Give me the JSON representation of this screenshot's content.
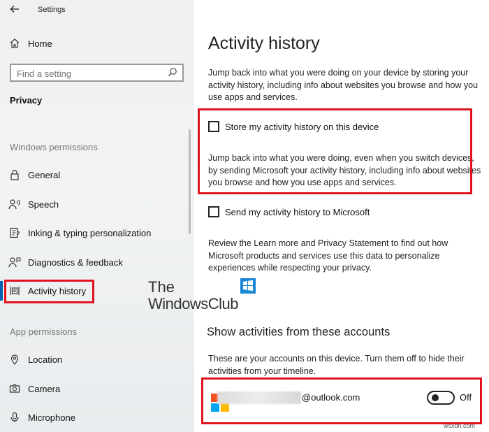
{
  "window": {
    "title": "Settings"
  },
  "sidebar": {
    "home_label": "Home",
    "search_placeholder": "Find a setting",
    "category": "Privacy",
    "windows_permissions_heading": "Windows permissions",
    "windows_items": [
      {
        "label": "General",
        "icon": "lock-icon"
      },
      {
        "label": "Speech",
        "icon": "speech-icon"
      },
      {
        "label": "Inking & typing personalization",
        "icon": "inking-icon"
      },
      {
        "label": "Diagnostics & feedback",
        "icon": "diagnostics-icon"
      },
      {
        "label": "Activity history",
        "icon": "activity-history-icon",
        "selected": true
      }
    ],
    "app_permissions_heading": "App permissions",
    "app_items": [
      {
        "label": "Location",
        "icon": "location-icon"
      },
      {
        "label": "Camera",
        "icon": "camera-icon"
      },
      {
        "label": "Microphone",
        "icon": "microphone-icon"
      }
    ]
  },
  "main": {
    "title": "Activity history",
    "intro": "Jump back into what you were doing on your device by storing your activity history, including info about websites you browse and how you use apps and services.",
    "store_checkbox": {
      "label": "Store my activity history on this device",
      "checked": false
    },
    "store_description": "Jump back into what you were doing, even when you switch devices, by sending Microsoft your activity history, including info about websites you browse and how you use apps and services.",
    "send_checkbox": {
      "label": "Send my activity history to Microsoft",
      "checked": false
    },
    "review_text": "Review the Learn more and Privacy Statement to find out how Microsoft products and services use this data to personalize experiences while respecting your privacy.",
    "accounts_heading": "Show activities from these accounts",
    "accounts_description": "These are your accounts on this device. Turn them off to hide their activities from your timeline.",
    "account": {
      "email": "@outlook.com",
      "toggle_state": "Off"
    }
  },
  "watermark": {
    "line1": "The",
    "line2": "WindowsClub"
  },
  "site_mark": "wsxdn.com",
  "colors": {
    "accent": "#0063b1",
    "highlight": "#e0141e",
    "ms_red": "#f25022",
    "ms_green": "#7fba00",
    "ms_blue": "#00a4ef",
    "ms_yellow": "#ffb900"
  }
}
